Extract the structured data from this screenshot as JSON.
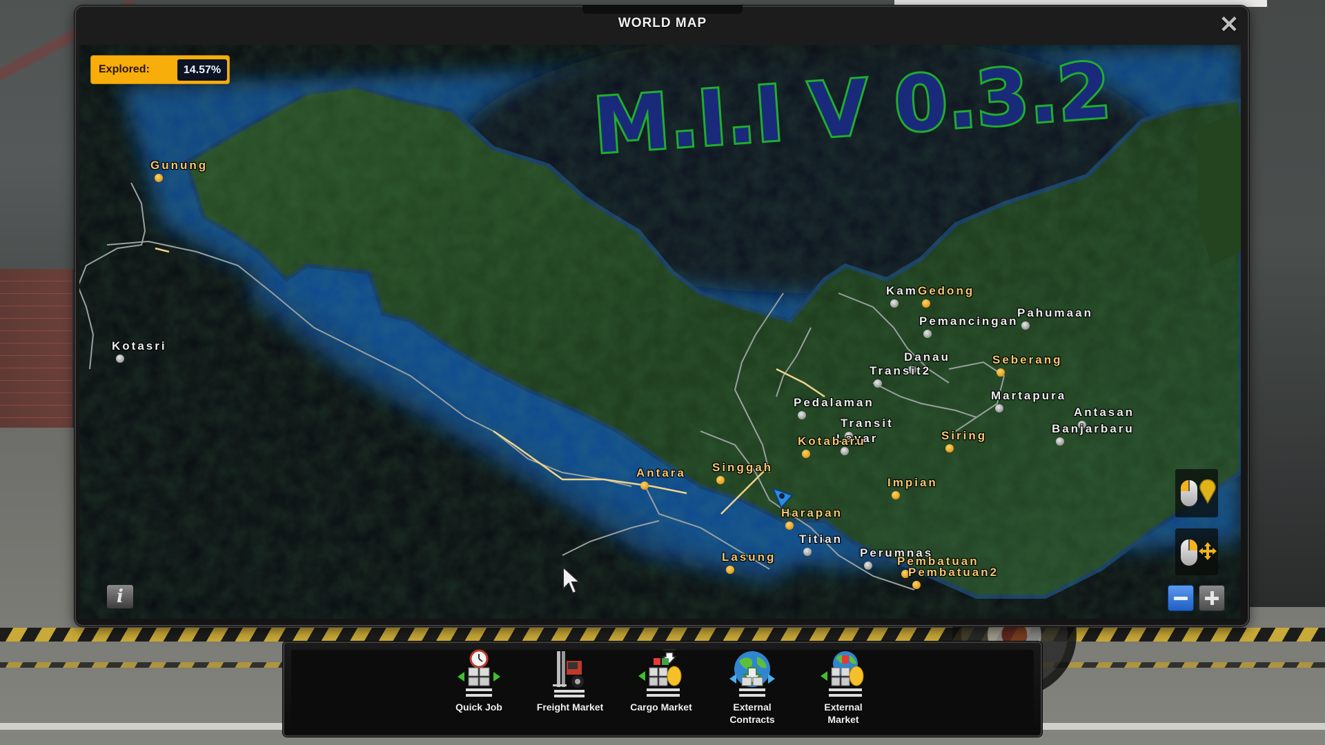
{
  "window": {
    "title": "WORLD MAP",
    "close_icon": "close-x-icon"
  },
  "explored": {
    "label": "Explored:",
    "value": "14.57%",
    "percent": 14.57,
    "badge_color": "#f7ad0a",
    "value_bg": "#0c1424"
  },
  "watermark": {
    "text": "M.I.I V 0.3.2",
    "fill": "#1a2a7a",
    "stroke": "#1fae2c"
  },
  "map": {
    "colors": {
      "land": "#1e3b1f",
      "sea": "#0d3e7c",
      "void": "#0a0d12",
      "road": "#9aa0a0",
      "owned_road": "#f2d48a"
    },
    "cities": [
      {
        "name": "Gunung",
        "type": "owned"
      },
      {
        "name": "Kotasri",
        "type": "other"
      },
      {
        "name": "Kam",
        "type": "other"
      },
      {
        "name": "Gedong",
        "type": "owned"
      },
      {
        "name": "Pahumaan",
        "type": "other"
      },
      {
        "name": "Pemancingan",
        "type": "other"
      },
      {
        "name": "Danau",
        "type": "other"
      },
      {
        "name": "Transit2",
        "type": "other"
      },
      {
        "name": "Seberang",
        "type": "owned"
      },
      {
        "name": "Martapura",
        "type": "other"
      },
      {
        "name": "Antasan",
        "type": "other"
      },
      {
        "name": "Banjarbaru",
        "type": "other"
      },
      {
        "name": "Pedalaman",
        "type": "other"
      },
      {
        "name": "Transit",
        "type": "other"
      },
      {
        "name": "Layar",
        "type": "other"
      },
      {
        "name": "Kotabaru",
        "type": "owned"
      },
      {
        "name": "Siring",
        "type": "owned"
      },
      {
        "name": "Impian",
        "type": "owned"
      },
      {
        "name": "Antara",
        "type": "owned"
      },
      {
        "name": "Singgah",
        "type": "owned"
      },
      {
        "name": "Harapan",
        "type": "owned"
      },
      {
        "name": "Titian",
        "type": "other"
      },
      {
        "name": "Lasung",
        "type": "owned"
      },
      {
        "name": "Perumnas",
        "type": "other"
      },
      {
        "name": "Pembatuan",
        "type": "owned"
      },
      {
        "name": "Pembatuan2",
        "type": "owned"
      }
    ],
    "player_marker": "player-truck-arrow-icon",
    "controls": {
      "left_click_hint": "set-waypoint",
      "right_click_hint": "pan-map",
      "zoom_out": "zoom-out-icon",
      "zoom_in": "zoom-in-icon",
      "info": "i"
    }
  },
  "toolbar": {
    "items": [
      {
        "label": "Quick Job",
        "icon": "quick-job-icon"
      },
      {
        "label": "Freight Market",
        "icon": "freight-market-icon"
      },
      {
        "label": "Cargo Market",
        "icon": "cargo-market-icon"
      },
      {
        "label": "External Contracts",
        "label_line1": "External",
        "label_line2": "Contracts",
        "icon": "external-contracts-icon"
      },
      {
        "label": "External Market",
        "label_line1": "External",
        "label_line2": "Market",
        "icon": "external-market-icon"
      }
    ]
  }
}
